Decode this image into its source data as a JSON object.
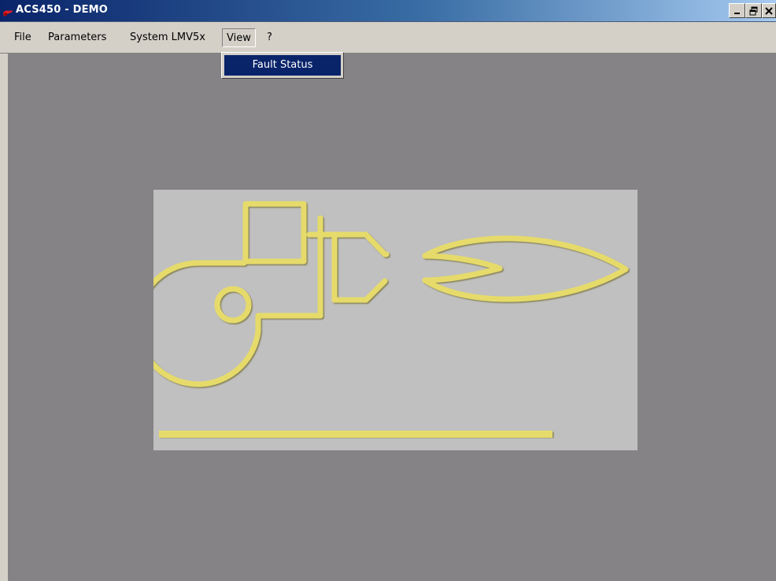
{
  "window": {
    "title": "ACS450 - DEMO",
    "controls": {
      "minimize": "_",
      "restore": "&#9633;",
      "close": "X"
    }
  },
  "menubar": {
    "items": [
      {
        "label": "File"
      },
      {
        "label": "Parameters"
      },
      {
        "label": "System LMV5x"
      },
      {
        "label": "View",
        "open": true
      },
      {
        "label": "?"
      }
    ]
  },
  "dropdown": {
    "parent": "View",
    "items": [
      {
        "label": "Fault Status",
        "highlighted": true
      }
    ]
  },
  "colors": {
    "title_gradient_start": "#0a246a",
    "title_gradient_end": "#a6caf0",
    "workspace": "#858385",
    "panel": "#c0c0c0",
    "burner_graphic": "#e6db6a"
  },
  "graphic": {
    "icon": "burner-flame-diagram",
    "level_bar": "flame-signal-bar"
  }
}
